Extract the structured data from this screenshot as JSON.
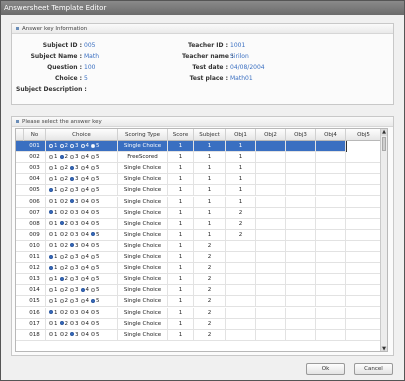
{
  "window": {
    "title": "Answersheet Template Editor"
  },
  "info_panel": {
    "title": "Answer key Information",
    "subject_id_label": "Subject ID :",
    "subject_id": "005",
    "subject_name_label": "Subject Name :",
    "subject_name": "Math",
    "question_label": "Question :",
    "question": "100",
    "choice_label": "Choice :",
    "choice": "5",
    "description_label": "Subject Description :",
    "teacher_id_label": "Teacher ID :",
    "teacher_id": "1001",
    "teacher_name_label": "Teacher name :",
    "teacher_name": "Sirilon",
    "test_date_label": "Test date :",
    "test_date": "04/08/2004",
    "test_place_label": "Test place :",
    "test_place": "Math01"
  },
  "answer_panel": {
    "title": "Please select the answer key",
    "columns": [
      "No",
      "Choice",
      "Scoring Type",
      "Score",
      "Subject",
      "Obj1",
      "Obj2",
      "Obj3",
      "Obj4",
      "Obj5"
    ],
    "choice_labels": [
      "1",
      "2",
      "3",
      "4",
      "5"
    ],
    "row_indicator": "»",
    "rows": [
      {
        "no": "001",
        "selected": [
          1,
          2,
          3,
          4
        ],
        "type": "Single Choice",
        "score": "1",
        "subject": "1",
        "obj1": "1",
        "highlight": true
      },
      {
        "no": "002",
        "selected": [
          2
        ],
        "type": "FreeScored",
        "score": "1",
        "subject": "1",
        "obj1": "1"
      },
      {
        "no": "003",
        "selected": [
          3
        ],
        "type": "Single Choice",
        "score": "1",
        "subject": "1",
        "obj1": "1"
      },
      {
        "no": "004",
        "selected": [
          3
        ],
        "type": "Single Choice",
        "score": "1",
        "subject": "1",
        "obj1": "1"
      },
      {
        "no": "005",
        "selected": [
          1
        ],
        "type": "Single Choice",
        "score": "1",
        "subject": "1",
        "obj1": "1"
      },
      {
        "no": "006",
        "selected": [
          3
        ],
        "type": "Single Choice",
        "score": "1",
        "subject": "1",
        "obj1": "1"
      },
      {
        "no": "007",
        "selected": [
          1
        ],
        "type": "Single Choice",
        "score": "1",
        "subject": "1",
        "obj1": "2"
      },
      {
        "no": "008",
        "selected": [
          2
        ],
        "type": "Single Choice",
        "score": "1",
        "subject": "1",
        "obj1": "2"
      },
      {
        "no": "009",
        "selected": [
          5
        ],
        "type": "Single Choice",
        "score": "1",
        "subject": "1",
        "obj1": "2"
      },
      {
        "no": "010",
        "selected": [
          3
        ],
        "type": "Single Choice",
        "score": "1",
        "subject": "2",
        "obj1": ""
      },
      {
        "no": "011",
        "selected": [
          1
        ],
        "type": "Single Choice",
        "score": "1",
        "subject": "2",
        "obj1": ""
      },
      {
        "no": "012",
        "selected": [
          1
        ],
        "type": "Single Choice",
        "score": "1",
        "subject": "2",
        "obj1": ""
      },
      {
        "no": "013",
        "selected": [
          2
        ],
        "type": "Single Choice",
        "score": "1",
        "subject": "2",
        "obj1": ""
      },
      {
        "no": "014",
        "selected": [
          4
        ],
        "type": "Single Choice",
        "score": "1",
        "subject": "2",
        "obj1": ""
      },
      {
        "no": "015",
        "selected": [
          5
        ],
        "type": "Single Choice",
        "score": "1",
        "subject": "2",
        "obj1": ""
      },
      {
        "no": "016",
        "selected": [
          1
        ],
        "type": "Single Choice",
        "score": "1",
        "subject": "2",
        "obj1": ""
      },
      {
        "no": "017",
        "selected": [
          2
        ],
        "type": "Single Choice",
        "score": "1",
        "subject": "2",
        "obj1": ""
      },
      {
        "no": "018",
        "selected": [
          3
        ],
        "type": "Single Choice",
        "score": "1",
        "subject": "2",
        "obj1": ""
      }
    ]
  },
  "buttons": {
    "ok": "Ok",
    "cancel": "Cancel"
  },
  "icons": {
    "scroll_up": "scroll-up-icon",
    "scroll_down": "scroll-down-icon",
    "row_pointer": "row-pointer-icon"
  },
  "colors": {
    "accent": "#3a6fc1",
    "selected_row": "#3a6fc1"
  }
}
